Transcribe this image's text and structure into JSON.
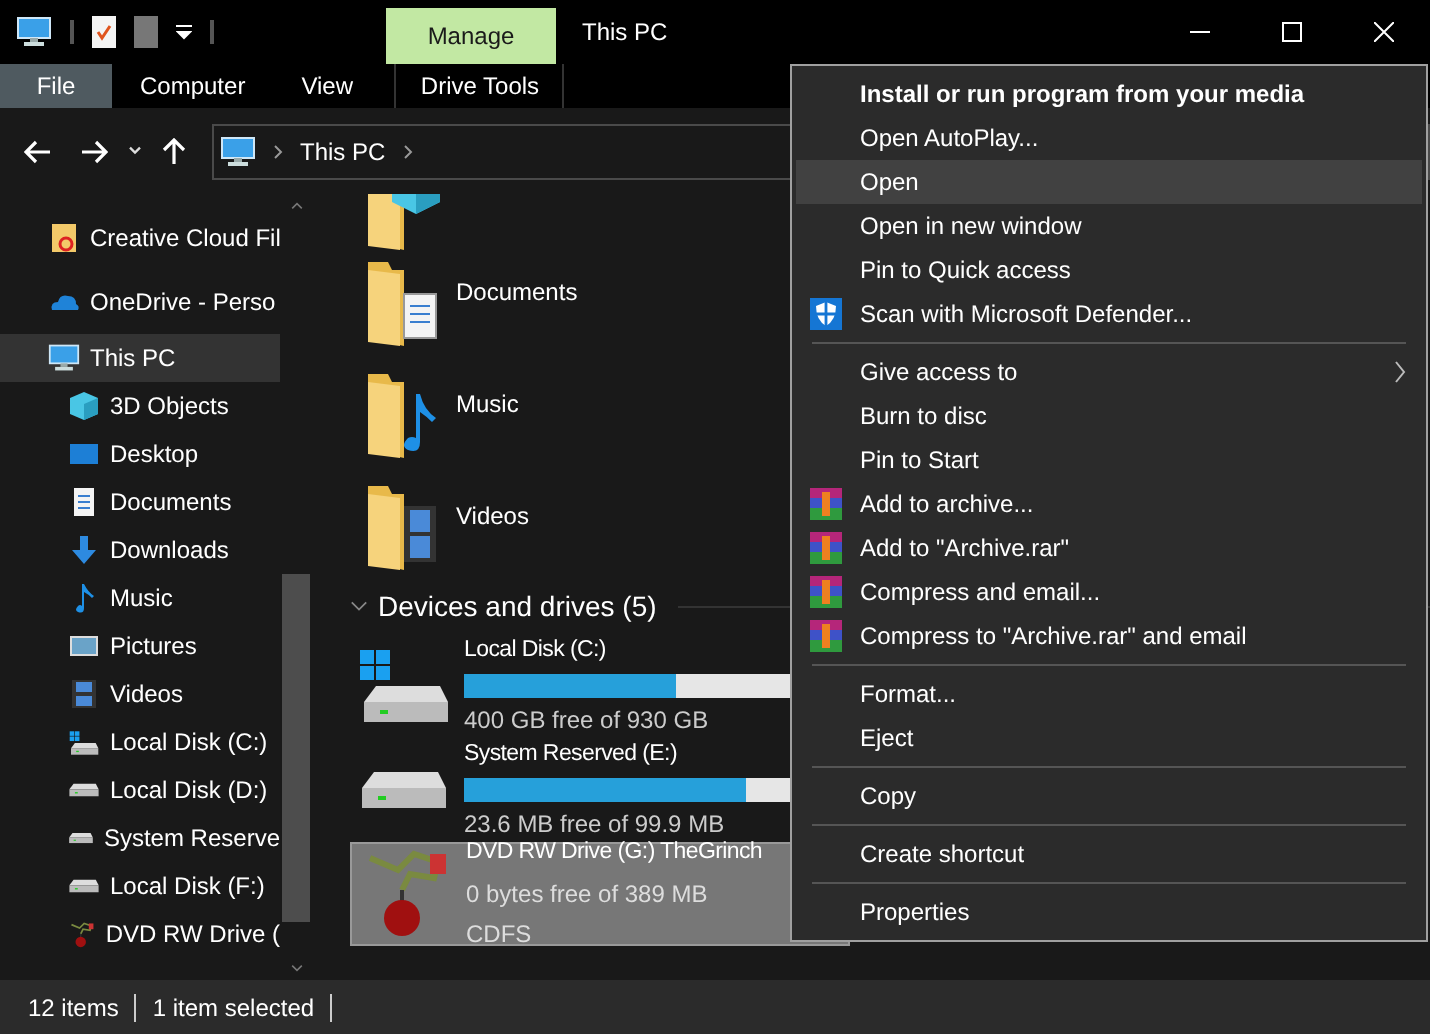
{
  "window": {
    "title": "This PC",
    "context_tab": "Manage"
  },
  "ribbon_tabs": [
    {
      "label": "File",
      "kind": "file"
    },
    {
      "label": "Computer",
      "kind": "tab"
    },
    {
      "label": "View",
      "kind": "tab"
    },
    {
      "label": "Drive Tools",
      "kind": "context"
    }
  ],
  "address": {
    "crumbs": [
      "This PC"
    ]
  },
  "sidebar": {
    "items": [
      {
        "label": "Creative Cloud Fil",
        "kind": "creative",
        "selected": false
      },
      {
        "label": "OneDrive - Perso",
        "kind": "cloud",
        "selected": false
      },
      {
        "label": "This PC",
        "kind": "pc",
        "selected": true,
        "children": [
          {
            "label": "3D Objects",
            "kind": "cube",
            "selected": false
          },
          {
            "label": "Desktop",
            "kind": "desktop",
            "selected": false
          },
          {
            "label": "Documents",
            "kind": "documents",
            "selected": false
          },
          {
            "label": "Downloads",
            "kind": "downloads",
            "selected": false
          },
          {
            "label": "Music",
            "kind": "music",
            "selected": false
          },
          {
            "label": "Pictures",
            "kind": "pictures",
            "selected": false
          },
          {
            "label": "Videos",
            "kind": "videos",
            "selected": false
          },
          {
            "label": "Local Disk (C:)",
            "kind": "windrive",
            "selected": false
          },
          {
            "label": "Local Disk (D:)",
            "kind": "drive",
            "selected": false
          },
          {
            "label": "System Reserve",
            "kind": "drive",
            "selected": false
          },
          {
            "label": "Local Disk (F:)",
            "kind": "drive",
            "selected": false
          },
          {
            "label": "DVD RW Drive (",
            "kind": "dvd",
            "selected": false
          }
        ]
      }
    ]
  },
  "folders": [
    {
      "label": "Documents",
      "kind": "documents"
    },
    {
      "label": "Music",
      "kind": "music"
    },
    {
      "label": "Videos",
      "kind": "videos"
    }
  ],
  "devices": {
    "heading": "Devices and drives (5)",
    "expanded": true,
    "drives": [
      {
        "name": "Local Disk (C:)",
        "kind": "windrive",
        "level": 0.57,
        "reading": "400 GB free of 930 GB",
        "selected": false
      },
      {
        "name": "System Reserved (E:)",
        "kind": "drive",
        "level": 0.76,
        "reading": "23.6 MB free of 99.9 MB",
        "selected": false
      },
      {
        "name": "DVD RW Drive (G:) TheGrinch",
        "kind": "dvd",
        "reading": "0 bytes free of 389 MB",
        "filesystem": "CDFS",
        "selected": true
      }
    ]
  },
  "context_menu": [
    {
      "kind": "item",
      "label": "Install or run program from your media",
      "bold": true,
      "selected": false
    },
    {
      "kind": "item",
      "label": "Open AutoPlay...",
      "bold": false,
      "selected": false
    },
    {
      "kind": "item",
      "label": "Open",
      "bold": false,
      "selected": true
    },
    {
      "kind": "item",
      "label": "Open in new window",
      "bold": false,
      "selected": false
    },
    {
      "kind": "item",
      "label": "Pin to Quick access",
      "bold": false,
      "selected": false
    },
    {
      "kind": "defender",
      "label": "Scan with Microsoft Defender...",
      "bold": false,
      "selected": false
    },
    {
      "kind": "separator"
    },
    {
      "kind": "submenu",
      "label": "Give access to",
      "bold": false,
      "selected": false
    },
    {
      "kind": "item",
      "label": "Burn to disc",
      "bold": false,
      "selected": false
    },
    {
      "kind": "item",
      "label": "Pin to Start",
      "bold": false,
      "selected": false
    },
    {
      "kind": "archive",
      "label": "Add to archive...",
      "bold": false,
      "selected": false
    },
    {
      "kind": "archive",
      "label": "Add to \"Archive.rar\"",
      "bold": false,
      "selected": false
    },
    {
      "kind": "archive",
      "label": "Compress and email...",
      "bold": false,
      "selected": false
    },
    {
      "kind": "archive",
      "label": "Compress to \"Archive.rar\" and email",
      "bold": false,
      "selected": false
    },
    {
      "kind": "separator"
    },
    {
      "kind": "item",
      "label": "Format...",
      "bold": false,
      "selected": false
    },
    {
      "kind": "item",
      "label": "Eject",
      "bold": false,
      "selected": false
    },
    {
      "kind": "separator"
    },
    {
      "kind": "item",
      "label": "Copy",
      "bold": false,
      "selected": false
    },
    {
      "kind": "separator"
    },
    {
      "kind": "item",
      "label": "Create shortcut",
      "bold": false,
      "selected": false
    },
    {
      "kind": "separator"
    },
    {
      "kind": "item",
      "label": "Properties",
      "bold": false,
      "selected": false
    }
  ],
  "status_bar": [
    "12 items",
    "1 item selected"
  ]
}
